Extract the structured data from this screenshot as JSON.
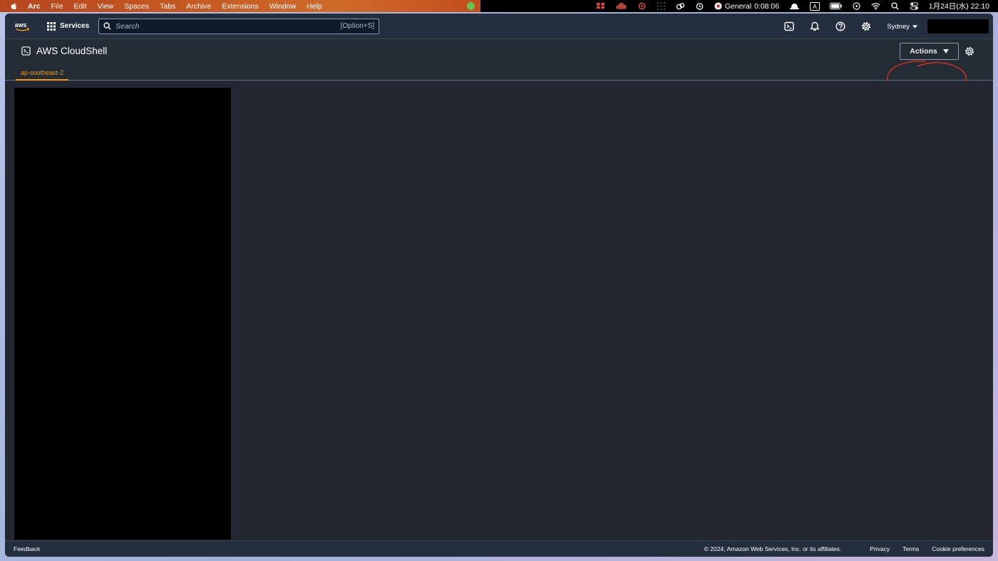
{
  "menubar": {
    "app_name": "Arc",
    "items": [
      "File",
      "Edit",
      "View",
      "Spaces",
      "Tabs",
      "Archive",
      "Extensions",
      "Window",
      "Help"
    ],
    "focus_label": "General",
    "focus_timer": "0:08:06",
    "input_indicator": "A",
    "datetime": "1月24日(水)  22:10"
  },
  "header": {
    "services_label": "Services",
    "search_placeholder": "Search",
    "search_shortcut": "[Option+S]",
    "region_label": "Sydney"
  },
  "cloudshell": {
    "title": "AWS CloudShell",
    "tab_label": "ap-southeast-2",
    "actions_label": "Actions"
  },
  "footer": {
    "feedback": "Feedback",
    "copyright": "© 2024, Amazon Web Services, Inc. or its affiliates.",
    "privacy": "Privacy",
    "terms": "Terms",
    "cookie": "Cookie preferences"
  },
  "colors": {
    "accent": "#ff9900",
    "annotation": "#e0301e",
    "header_bg": "#232f3e",
    "content_bg": "#232731"
  }
}
